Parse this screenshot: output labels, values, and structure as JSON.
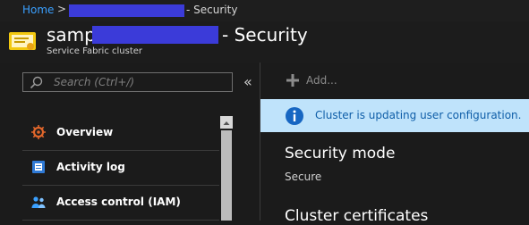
{
  "breadcrumb": {
    "home": "Home",
    "separator": ">",
    "current": "- Security"
  },
  "header": {
    "title_prefix": "sampl",
    "title_suffix": "- Security",
    "subtitle": "Service Fabric cluster",
    "icon": "certificate-icon"
  },
  "sidebar": {
    "search_placeholder": "Search (Ctrl+/)",
    "collapse_glyph": "«",
    "items": [
      {
        "label": "Overview",
        "icon": "overview-gear-icon"
      },
      {
        "label": "Activity log",
        "icon": "activity-log-icon"
      },
      {
        "label": "Access control (IAM)",
        "icon": "people-icon"
      }
    ]
  },
  "toolbar": {
    "add_label": "Add..."
  },
  "banner": {
    "text": "Cluster is updating user configuration.",
    "icon": "info-icon"
  },
  "main": {
    "security_mode_heading": "Security mode",
    "security_mode_value": "Secure",
    "certificates_heading": "Cluster certificates"
  },
  "colors": {
    "accent": "#3aa0ff",
    "redaction": "#3b3bd9",
    "banner_bg": "#bfe3fb",
    "banner_text": "#0f5ea8"
  }
}
